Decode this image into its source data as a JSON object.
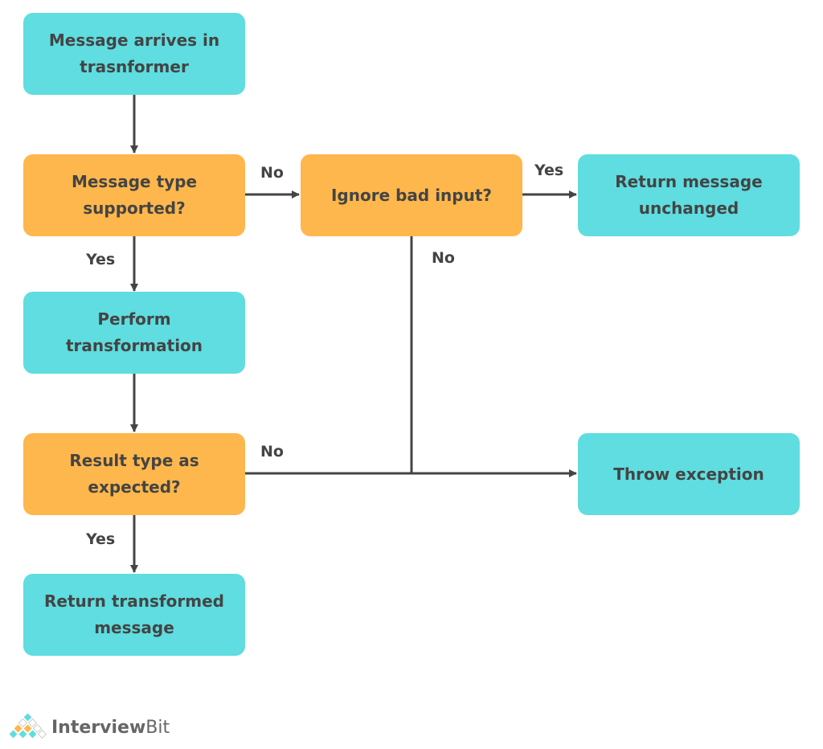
{
  "nodes": {
    "start": "Message arrives in trasnformer",
    "supported": "Message type supported?",
    "transform": "Perform transformation",
    "result": "Result type as expected?",
    "return_transformed": "Return transformed message",
    "ignore": "Ignore bad input?",
    "return_unchanged": "Return message unchanged",
    "throw": "Throw exception"
  },
  "edge_labels": {
    "supported_no": "No",
    "ignore_yes": "Yes",
    "supported_yes": "Yes",
    "ignore_no": "No",
    "result_no": "No",
    "result_yes": "Yes"
  },
  "colors": {
    "process": "#5fdde0",
    "decision": "#feb74c",
    "text": "#444444",
    "line": "#444444"
  },
  "logo": {
    "text_main": "Interview",
    "text_bold": "Bit"
  }
}
